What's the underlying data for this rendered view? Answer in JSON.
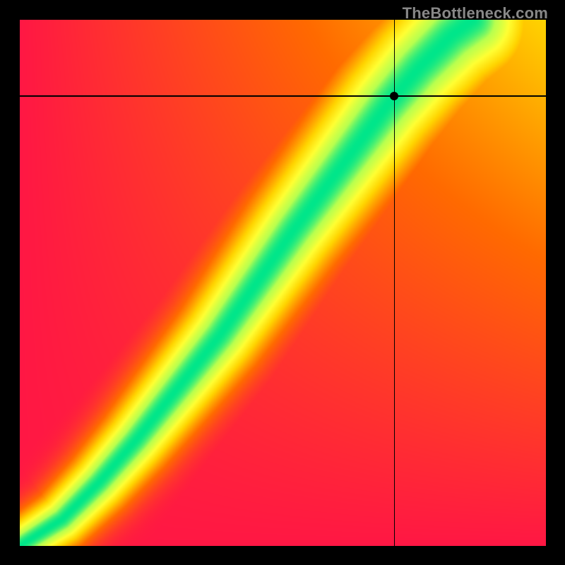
{
  "watermark": "TheBottleneck.com",
  "chart_data": {
    "type": "heatmap",
    "title": "",
    "xlabel": "",
    "ylabel": "",
    "xlim": [
      0,
      1
    ],
    "ylim": [
      0,
      1
    ],
    "grid": false,
    "legend": false,
    "marker": {
      "x": 0.712,
      "y": 0.855
    },
    "crosshair": {
      "x": 0.712,
      "y": 0.855
    },
    "colormap_stops": [
      {
        "t": 0.0,
        "color": "#ff1744"
      },
      {
        "t": 0.3,
        "color": "#ff6a00"
      },
      {
        "t": 0.55,
        "color": "#ffd400"
      },
      {
        "t": 0.72,
        "color": "#ffff33"
      },
      {
        "t": 0.88,
        "color": "#b8ff4f"
      },
      {
        "t": 1.0,
        "color": "#00e68a"
      }
    ],
    "ridge": {
      "description": "optimal-match curve; fitness = 1 along this curve and falls off with distance",
      "points": [
        {
          "x": 0.0,
          "y": 0.0
        },
        {
          "x": 0.08,
          "y": 0.05
        },
        {
          "x": 0.15,
          "y": 0.12
        },
        {
          "x": 0.22,
          "y": 0.2
        },
        {
          "x": 0.3,
          "y": 0.3
        },
        {
          "x": 0.38,
          "y": 0.4
        },
        {
          "x": 0.45,
          "y": 0.5
        },
        {
          "x": 0.52,
          "y": 0.6
        },
        {
          "x": 0.58,
          "y": 0.68
        },
        {
          "x": 0.64,
          "y": 0.76
        },
        {
          "x": 0.7,
          "y": 0.84
        },
        {
          "x": 0.76,
          "y": 0.91
        },
        {
          "x": 0.82,
          "y": 0.97
        },
        {
          "x": 0.86,
          "y": 1.0
        }
      ],
      "half_width_base": 0.035,
      "half_width_growth": 0.06
    },
    "corner_fitness": {
      "bottom_left": 0.0,
      "bottom_right": 0.0,
      "top_left": 0.0,
      "top_right": 0.55
    }
  }
}
